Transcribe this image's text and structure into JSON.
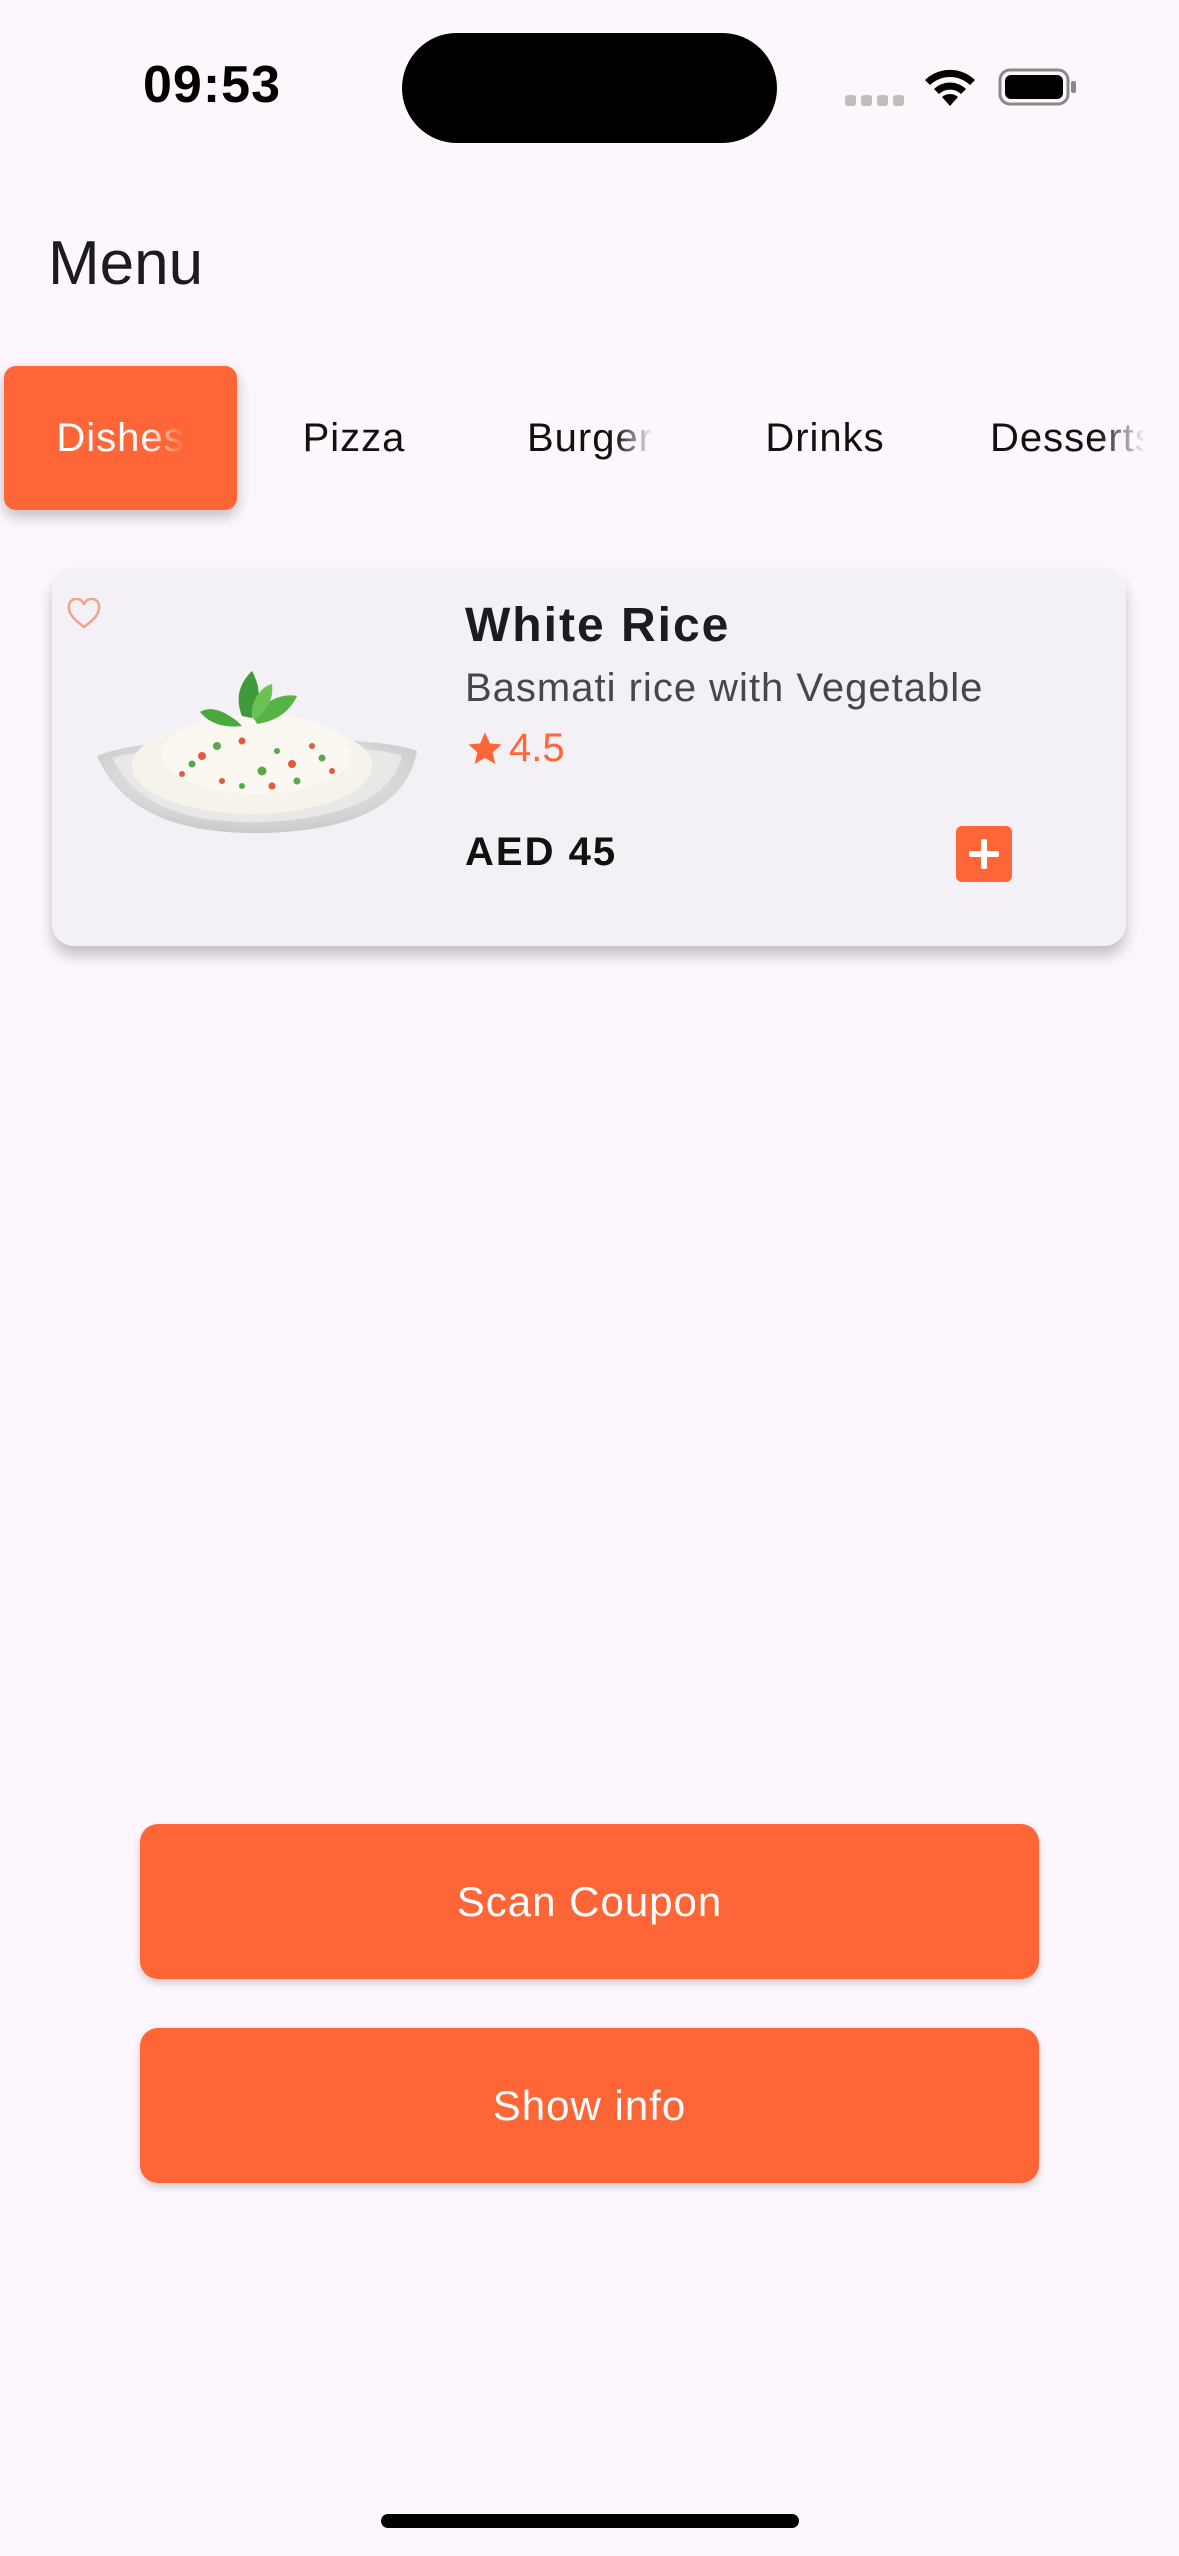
{
  "status_bar": {
    "time": "09:53"
  },
  "header": {
    "title": "Menu"
  },
  "tabs": [
    {
      "label": "Dishes",
      "active": true
    },
    {
      "label": "Pizza",
      "active": false
    },
    {
      "label": "Burger",
      "active": false
    },
    {
      "label": "Drinks",
      "active": false
    },
    {
      "label": "Desserts",
      "active": false
    }
  ],
  "menu_items": [
    {
      "name": "White Rice",
      "description": "Basmati rice with Vegetable",
      "rating": "4.5",
      "price": "AED 45",
      "favorite": false,
      "icons": {
        "favorite": "heart-outline-icon",
        "rating": "star-icon",
        "add": "plus-icon"
      }
    }
  ],
  "actions": {
    "scan_coupon": "Scan Coupon",
    "show_info": "Show info"
  },
  "colors": {
    "accent": "#fe6537",
    "background": "#fdf7fd",
    "card": "#f4f1f6"
  }
}
